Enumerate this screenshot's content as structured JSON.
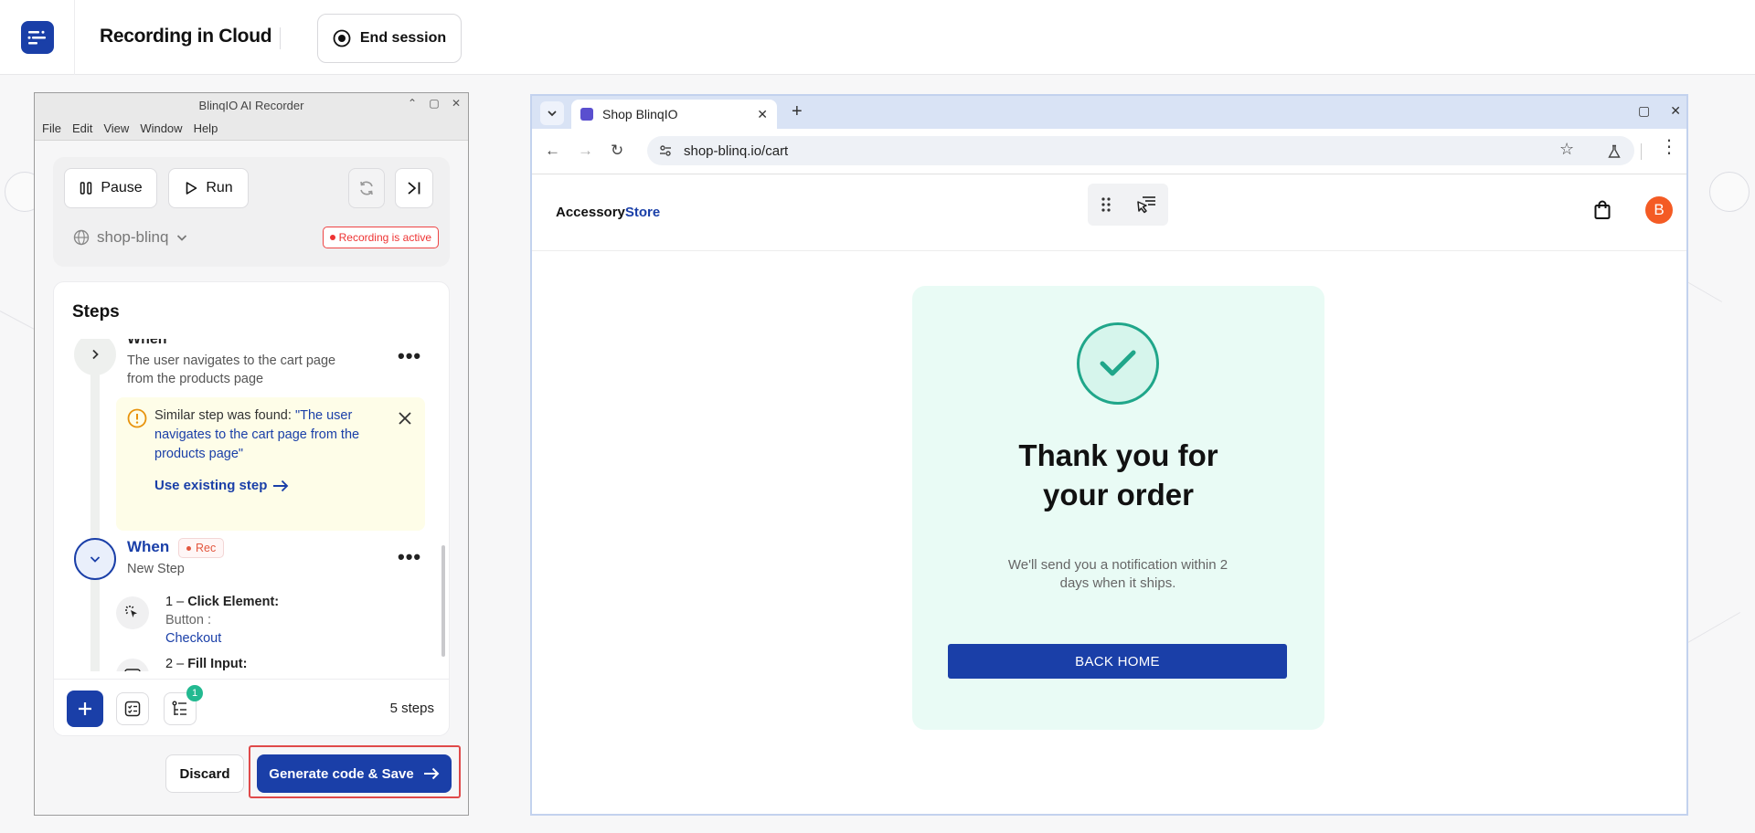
{
  "app": {
    "title": "Recording in Cloud",
    "end_session_label": "End session"
  },
  "recorder": {
    "window_title": "BlinqIO AI Recorder",
    "menu": [
      "File",
      "Edit",
      "View",
      "Window",
      "Help"
    ],
    "pause_label": "Pause",
    "run_label": "Run",
    "project_name": "shop-blinq",
    "recording_status": "Recording is active",
    "steps_title": "Steps",
    "step1": {
      "keyword": "When",
      "text": "The user navigates to the cart page from the products page"
    },
    "warning": {
      "prefix": "Similar step was found: ",
      "quote": "\"The user navigates to the cart page from the products page\"",
      "link_label": "Use existing step"
    },
    "step2": {
      "keyword": "When",
      "rec_badge": "Rec",
      "subtitle": "New Step",
      "actions": [
        {
          "index": "1",
          "action": "Click Element:",
          "target_type": "Button :",
          "target_name": "Checkout"
        },
        {
          "index": "2",
          "action": "Fill Input:"
        }
      ]
    },
    "badge_count": "1",
    "steps_count": "5 steps",
    "discard_label": "Discard",
    "generate_label": "Generate code & Save"
  },
  "browser": {
    "tab_title": "Shop BlinqIO",
    "url": "shop-blinq.io/cart",
    "brand_main": "Accessory",
    "brand_accent": "Store",
    "avatar_letter": "B",
    "thanks_title": "Thank you for your order",
    "thanks_sub": "We'll send you a notification within 2 days when it ships.",
    "back_home_label": "BACK HOME"
  },
  "colors": {
    "brand_blue": "#1a3fa8",
    "recording_red": "#e33333",
    "success_green": "#20a68a",
    "warning_bg": "#fefde8",
    "avatar_orange": "#f45b24"
  },
  "icons": [
    "logo-icon",
    "record-icon",
    "pause-icon",
    "play-icon",
    "refresh-icon",
    "skip-end-icon",
    "globe-icon",
    "chevron-down-icon",
    "chevron-right-icon",
    "warning-icon",
    "close-icon",
    "arrow-right-icon",
    "click-icon",
    "keyboard-icon",
    "plus-icon",
    "checklist-icon",
    "tree-list-icon",
    "checkmark-icon",
    "cart-bag-icon",
    "star-icon",
    "lab-icon",
    "kebab-icon"
  ]
}
